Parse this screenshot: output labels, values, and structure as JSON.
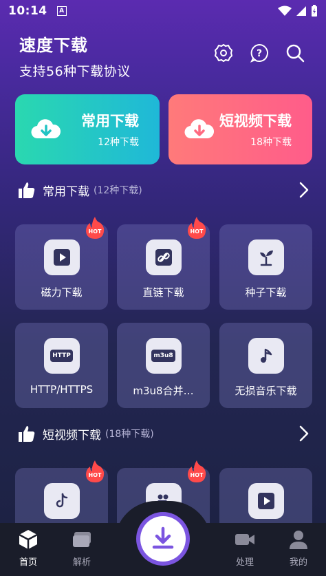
{
  "status": {
    "time": "10:14",
    "notif": "A"
  },
  "header": {
    "title": "速度下载",
    "subtitle": "支持56种下载协议"
  },
  "cards": {
    "common": {
      "title": "常用下载",
      "sub": "12种下载"
    },
    "short": {
      "title": "短视频下载",
      "sub": "18种下载"
    }
  },
  "sections": {
    "common": {
      "title": "常用下载",
      "count": "(12种下载)"
    },
    "short": {
      "title": "短视频下载",
      "count": "(18种下载)"
    }
  },
  "tiles": [
    {
      "label": "磁力下载",
      "hot": "HOT",
      "icon": "play-icon"
    },
    {
      "label": "直链下载",
      "hot": "HOT",
      "icon": "link-icon"
    },
    {
      "label": "种子下载",
      "icon": "sprout-icon"
    },
    {
      "label": "HTTP/HTTPS",
      "icon_text": "HTTP"
    },
    {
      "label": "m3u8合并…",
      "icon_text": "m3u8"
    },
    {
      "label": "无损音乐下载",
      "icon": "music-icon"
    }
  ],
  "short_tiles_hot": [
    "HOT",
    "HOT"
  ],
  "nav": {
    "home": "首页",
    "parse": "解析",
    "process": "处理",
    "mine": "我的"
  },
  "colors": {
    "accent": "#7b55e0",
    "card_common": "#1fb8d8",
    "card_short": "#ff5c8a"
  }
}
